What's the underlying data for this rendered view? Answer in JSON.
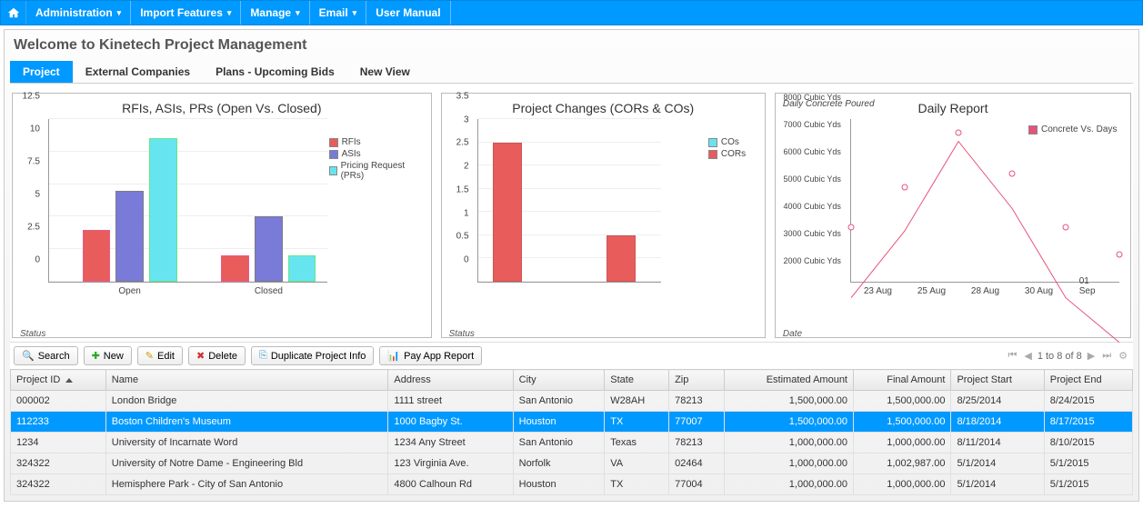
{
  "nav": {
    "items": [
      "Administration",
      "Import Features",
      "Manage",
      "Email",
      "User Manual"
    ],
    "dropdown_flags": [
      true,
      true,
      true,
      true,
      false
    ]
  },
  "page_title": "Welcome to Kinetech Project Management",
  "tabs": [
    "Project",
    "External Companies",
    "Plans - Upcoming Bids",
    "New View"
  ],
  "active_tab": 0,
  "chart_data": [
    {
      "type": "bar",
      "title": "RFIs, ASIs, PRs (Open Vs. Closed)",
      "categories": [
        "Open",
        "Closed"
      ],
      "series": [
        {
          "name": "RFIs",
          "color": "#e85c5c",
          "values": [
            4,
            2
          ]
        },
        {
          "name": "ASIs",
          "color": "#7a7ad8",
          "values": [
            7,
            5
          ]
        },
        {
          "name": "Pricing Request (PRs)",
          "color": "#66e5f0",
          "values": [
            11,
            2
          ]
        }
      ],
      "ylim": [
        0,
        12.5
      ],
      "yticks": [
        0,
        2.5,
        5,
        7.5,
        10,
        12.5
      ],
      "xlabel": "Status"
    },
    {
      "type": "bar",
      "title": "Project Changes (CORs & COs)",
      "categories": [
        ""
      ],
      "series": [
        {
          "name": "COs",
          "color": "#66e5f0",
          "values": [
            0
          ]
        },
        {
          "name": "CORs",
          "color": "#e85c5c",
          "values_left": 3,
          "values_right": 1
        }
      ],
      "ylim": [
        0,
        3.5
      ],
      "yticks": [
        0,
        0.5,
        1,
        1.5,
        2,
        2.5,
        3,
        3.5
      ],
      "xlabel": "Status"
    },
    {
      "type": "line",
      "title": "Daily Report",
      "subtitle": "Daily Concrete Poured",
      "x": [
        "23 Aug",
        "25 Aug",
        "28 Aug",
        "30 Aug",
        "01 Sep"
      ],
      "series": [
        {
          "name": "Concrete Vs. Days",
          "color": "#e8527a",
          "values": [
            4000,
            5500,
            7500,
            6000,
            4000,
            3000
          ]
        }
      ],
      "yticks": [
        "2000 Cubic Yds",
        "3000 Cubic Yds",
        "4000 Cubic Yds",
        "5000 Cubic Yds",
        "6000 Cubic Yds",
        "7000 Cubic Yds",
        "8000 Cubic Yds"
      ],
      "ylim": [
        2000,
        8000
      ],
      "xlabel": "Date"
    }
  ],
  "toolbar": {
    "search": "Search",
    "new": "New",
    "edit": "Edit",
    "delete": "Delete",
    "duplicate": "Duplicate Project Info",
    "payapp": "Pay App Report"
  },
  "pager": {
    "text": "1 to 8 of 8"
  },
  "table": {
    "columns": [
      "Project ID",
      "Name",
      "Address",
      "City",
      "State",
      "Zip",
      "Estimated Amount",
      "Final Amount",
      "Project Start",
      "Project End"
    ],
    "sort_col": 0,
    "selected_row": 1,
    "rows": [
      [
        "000002",
        "London Bridge",
        "1111 street",
        "San Antonio",
        "W28AH",
        "78213",
        "1,500,000.00",
        "1,500,000.00",
        "8/25/2014",
        "8/24/2015"
      ],
      [
        "112233",
        "Boston Children's Museum",
        "1000 Bagby St.",
        "Houston",
        "TX",
        "77007",
        "1,500,000.00",
        "1,500,000.00",
        "8/18/2014",
        "8/17/2015"
      ],
      [
        "1234",
        "University of Incarnate Word",
        "1234 Any Street",
        "San Antonio",
        "Texas",
        "78213",
        "1,000,000.00",
        "1,000,000.00",
        "8/11/2014",
        "8/10/2015"
      ],
      [
        "324322",
        "University of Notre Dame - Engineering Bld",
        "123 Virginia Ave.",
        "Norfolk",
        "VA",
        "02464",
        "1,000,000.00",
        "1,002,987.00",
        "5/1/2014",
        "5/1/2015"
      ],
      [
        "324322",
        "Hemisphere Park - City of San Antonio",
        "4800 Calhoun Rd",
        "Houston",
        "TX",
        "77004",
        "1,000,000.00",
        "1,000,000.00",
        "5/1/2014",
        "5/1/2015"
      ]
    ]
  },
  "colors": {
    "primary": "#0099ff"
  }
}
